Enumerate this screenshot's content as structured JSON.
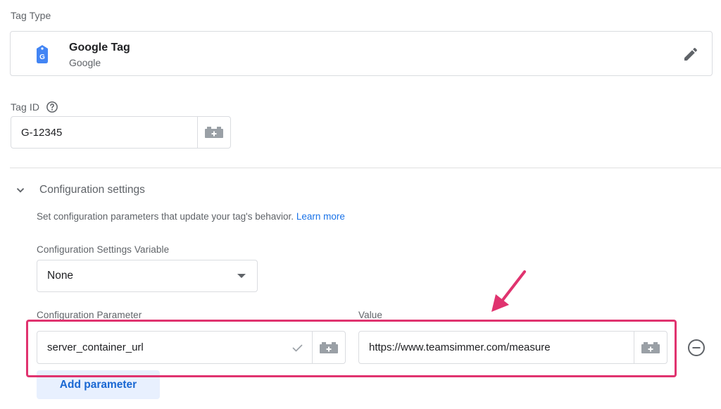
{
  "tag_type": {
    "label": "Tag Type",
    "name": "Google Tag",
    "vendor": "Google",
    "icon": "google-tag-icon",
    "edit_icon": "pencil-icon"
  },
  "tag_id": {
    "label": "Tag ID",
    "value": "G-12345",
    "help_icon": "help-circle-icon",
    "variable_icon": "variable-brick-icon"
  },
  "config": {
    "title": "Configuration settings",
    "description": "Set configuration parameters that update your tag's behavior.",
    "learn_more": "Learn more",
    "settings_variable_label": "Configuration Settings Variable",
    "settings_variable_value": "None",
    "param_label": "Configuration Parameter",
    "value_label": "Value",
    "rows": [
      {
        "parameter": "server_container_url",
        "value": "https://www.teamsimmer.com/measure"
      }
    ],
    "add_parameter": "Add parameter"
  },
  "colors": {
    "accent": "#1a73e8",
    "highlight": "#e0336f",
    "google_blue": "#4285f4"
  }
}
